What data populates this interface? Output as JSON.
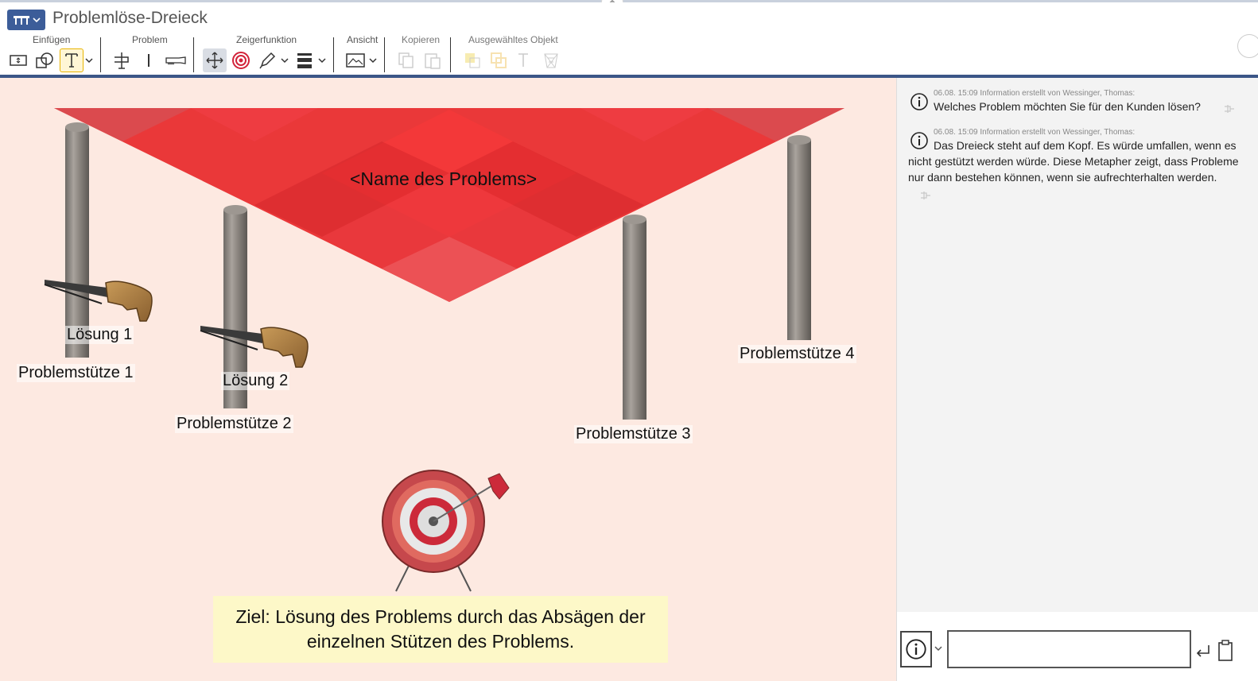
{
  "window": {
    "title": "Problemlöse-Dreieck"
  },
  "toolbar": {
    "groups": [
      {
        "label": "Einfügen"
      },
      {
        "label": "Problem"
      },
      {
        "label": "Zeigerfunktion"
      },
      {
        "label": "Ansicht"
      },
      {
        "label": "Kopieren"
      },
      {
        "label": "Ausgewähltes Objekt"
      }
    ]
  },
  "canvas": {
    "problem_name": "<Name des Problems>",
    "supports": [
      {
        "label": "Problemstütze 1"
      },
      {
        "label": "Problemstütze 2"
      },
      {
        "label": "Problemstütze 3"
      },
      {
        "label": "Problemstütze 4"
      }
    ],
    "solutions": [
      {
        "label": "Lösung 1"
      },
      {
        "label": "Lösung 2"
      }
    ],
    "goal": {
      "line1": "Ziel: Lösung des Problems durch das Absägen der",
      "line2": "einzelnen Stützen des Problems."
    },
    "colors": {
      "background": "#fde9e1",
      "triangle": "#e8282a",
      "goal_box": "#fdf8c8"
    }
  },
  "sidebar": {
    "messages": [
      {
        "meta": "06.08. 15:09 Information erstellt von Wessinger, Thomas:",
        "text": "Welches Problem möchten Sie für den Kunden lösen?"
      },
      {
        "meta": "06.08. 15:09 Information erstellt von Wessinger, Thomas:",
        "text": "Das Dreieck steht auf dem Kopf. Es würde umfallen, wenn es nicht gestützt werden würde. Diese Metapher zeigt, dass Probleme nur dann bestehen können, wenn sie aufrechterhalten werden."
      }
    ],
    "input": {
      "value": "",
      "placeholder": ""
    }
  }
}
